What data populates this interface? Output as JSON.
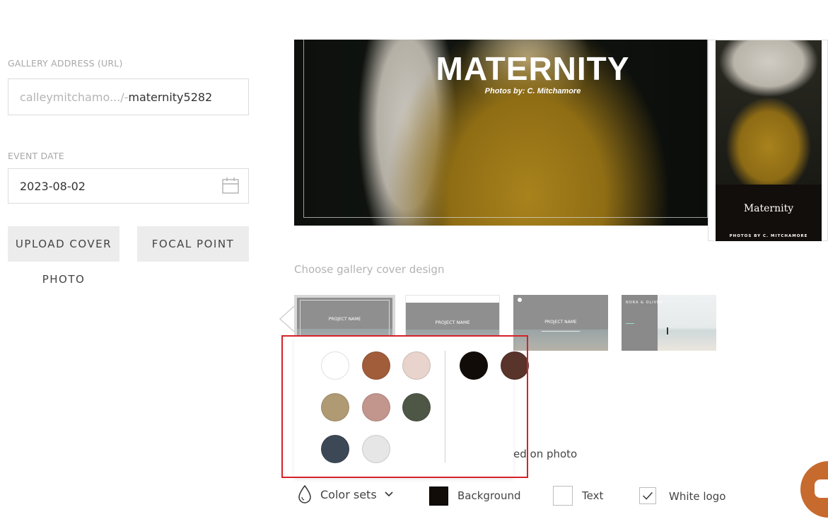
{
  "gallery": {
    "url_label": "GALLERY ADDRESS (URL)",
    "url_prefix": "calleymitchamo.../-",
    "url_slug": "maternity5282",
    "date_label": "EVENT DATE",
    "date_value": "2023-08-02",
    "upload_label": "UPLOAD COVER",
    "upload_label_cont": "PHOTO",
    "focal_label": "FOCAL POINT"
  },
  "cover": {
    "title": "MATERNITY",
    "subtitle": "Photos by: C. Mitchamore",
    "side_title": "Maternity",
    "side_subtitle": "PHOTOS BY C. MITCHAMORE"
  },
  "designs": {
    "label": "Choose gallery cover design",
    "thumbs": [
      {
        "title": "PROJECT NAME"
      },
      {
        "title": "PROJECT NAME"
      },
      {
        "title": "PROJECT NAME"
      },
      {
        "title": "NORA & OLIVER"
      }
    ]
  },
  "palette": {
    "swatches": [
      "#ffffff",
      "#a15c3a",
      "#e8d4cc",
      "#b09a74",
      "#c2958d",
      "#4e5746",
      "#3c4855",
      "#e6e6e6"
    ],
    "dark_swatches": [
      "#120c08",
      "#58342b"
    ],
    "on_photo_label": "ed on photo"
  },
  "toolbar": {
    "color_sets_label": "Color sets",
    "background_label": "Background",
    "background_color": "#120c08",
    "text_label": "Text",
    "text_color": "#ffffff",
    "white_logo_label": "White logo",
    "white_logo_checked": true
  },
  "colors": {
    "highlight": "#d5222a",
    "chat": "#c76a2e"
  }
}
